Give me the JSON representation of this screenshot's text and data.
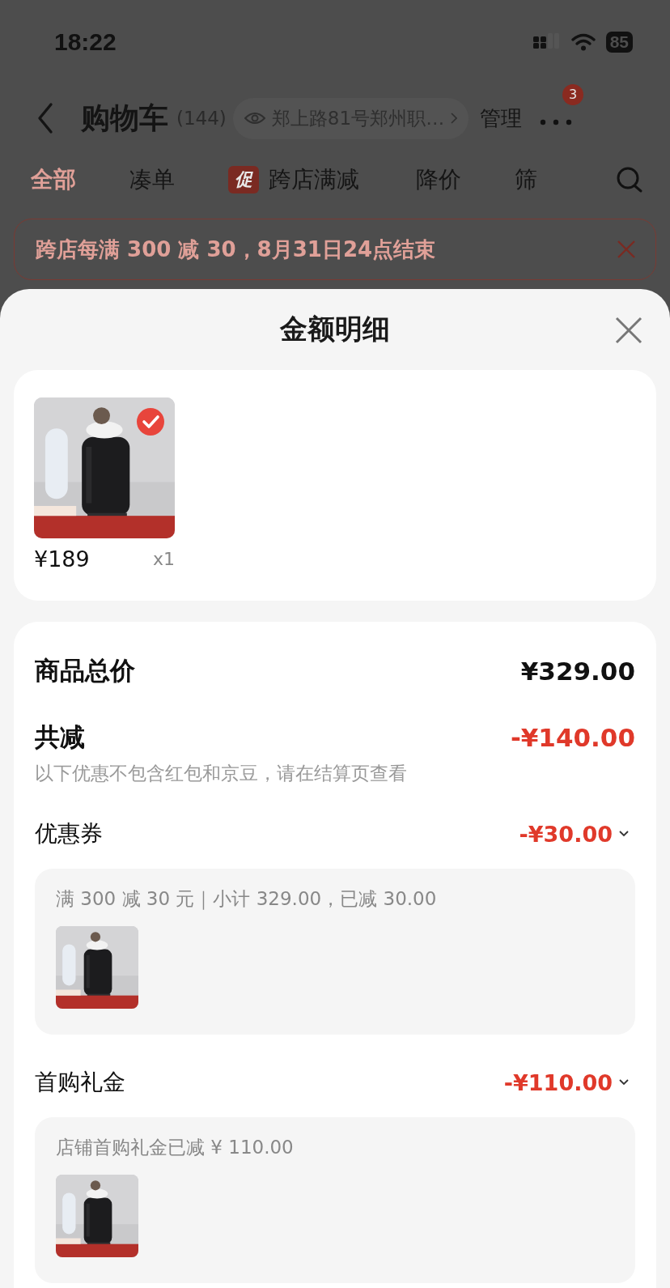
{
  "status_bar": {
    "time": "18:22",
    "battery": "85"
  },
  "header": {
    "title": "购物车",
    "count": "(144)",
    "address": "郑上路81号郑州职…",
    "manage": "管理",
    "more_badge": "3"
  },
  "tabs": [
    {
      "label": "全部",
      "selected": true
    },
    {
      "label": "凑单",
      "selected": false
    },
    {
      "label": "跨店满减",
      "selected": false,
      "badge": "促"
    },
    {
      "label": "降价",
      "selected": false
    },
    {
      "label": "筛",
      "selected": false
    }
  ],
  "promo_banner": {
    "text": "跨店每满 300 减 30，8月31日24点结束"
  },
  "sheet": {
    "title": "金额明细",
    "product": {
      "price": "¥189",
      "quantity": "x1",
      "checked": true
    },
    "total": {
      "label": "商品总价",
      "value": "¥329.00"
    },
    "discount": {
      "label": "共减",
      "value": "-¥140.00",
      "note": "以下优惠不包含红包和京豆，请在结算页查看"
    },
    "details": [
      {
        "label": "优惠券",
        "value": "-¥30.00",
        "expanded": true,
        "description": "满 300 减 30 元｜小计 329.00，已减 30.00"
      },
      {
        "label": "首购礼金",
        "value": "-¥110.00",
        "expanded": true,
        "description": "店铺首购礼金已减 ¥ 110.00"
      }
    ]
  }
}
